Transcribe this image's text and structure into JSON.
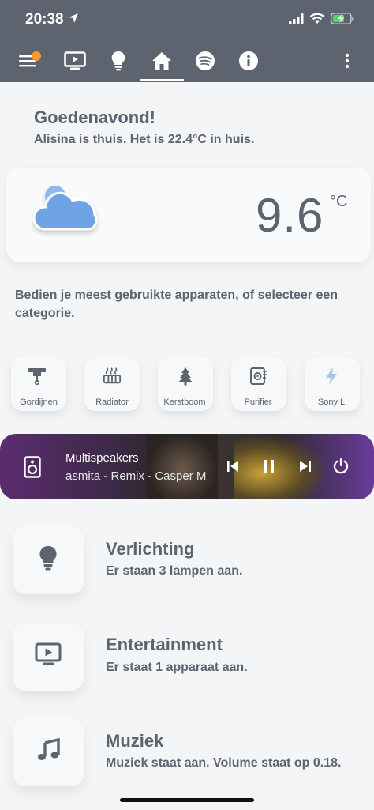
{
  "status_bar": {
    "time": "20:38"
  },
  "nav": {
    "items": [
      {
        "icon": "menu-icon"
      },
      {
        "icon": "tv-icon"
      },
      {
        "icon": "bulb-icon"
      },
      {
        "icon": "home-icon",
        "active": true
      },
      {
        "icon": "spotify-icon"
      },
      {
        "icon": "info-icon"
      },
      {
        "icon": "more-vertical-icon"
      }
    ],
    "notification_color": "#f49b2a"
  },
  "greeting": {
    "title": "Goedenavond!",
    "subtitle": "Alisina is thuis. Het is 22.4°C in huis."
  },
  "weather": {
    "icon": "cloud-icon",
    "temperature": "9.6",
    "unit": "°C"
  },
  "intro_text": "Bedien je meest gebruikte apparaten, of selecteer een categorie.",
  "devices": [
    {
      "label": "Gordijnen",
      "icon": "curtain-icon"
    },
    {
      "label": "Radiator",
      "icon": "radiator-icon"
    },
    {
      "label": "Kerstboom",
      "icon": "tree-icon"
    },
    {
      "label": "Purifier",
      "icon": "purifier-icon"
    },
    {
      "label": "Sony L",
      "icon": "flash-icon"
    }
  ],
  "player": {
    "title": "Multispeakers",
    "subtitle": "asmita - Remix - Casper M",
    "icon": "speaker-icon"
  },
  "categories": [
    {
      "title": "Verlichting",
      "subtitle": "Er staan 3 lampen aan.",
      "icon": "bulb-icon"
    },
    {
      "title": "Entertainment",
      "subtitle": "Er staat 1 apparaat aan.",
      "icon": "tv-icon"
    },
    {
      "title": "Muziek",
      "subtitle": "Muziek staat aan. Volume staat op 0.18.",
      "icon": "music-note-icon"
    }
  ],
  "colors": {
    "header": "#5d6470",
    "text": "#5c6470",
    "background": "#f4f5f6",
    "accent_cloud": "#6fa3e6"
  }
}
